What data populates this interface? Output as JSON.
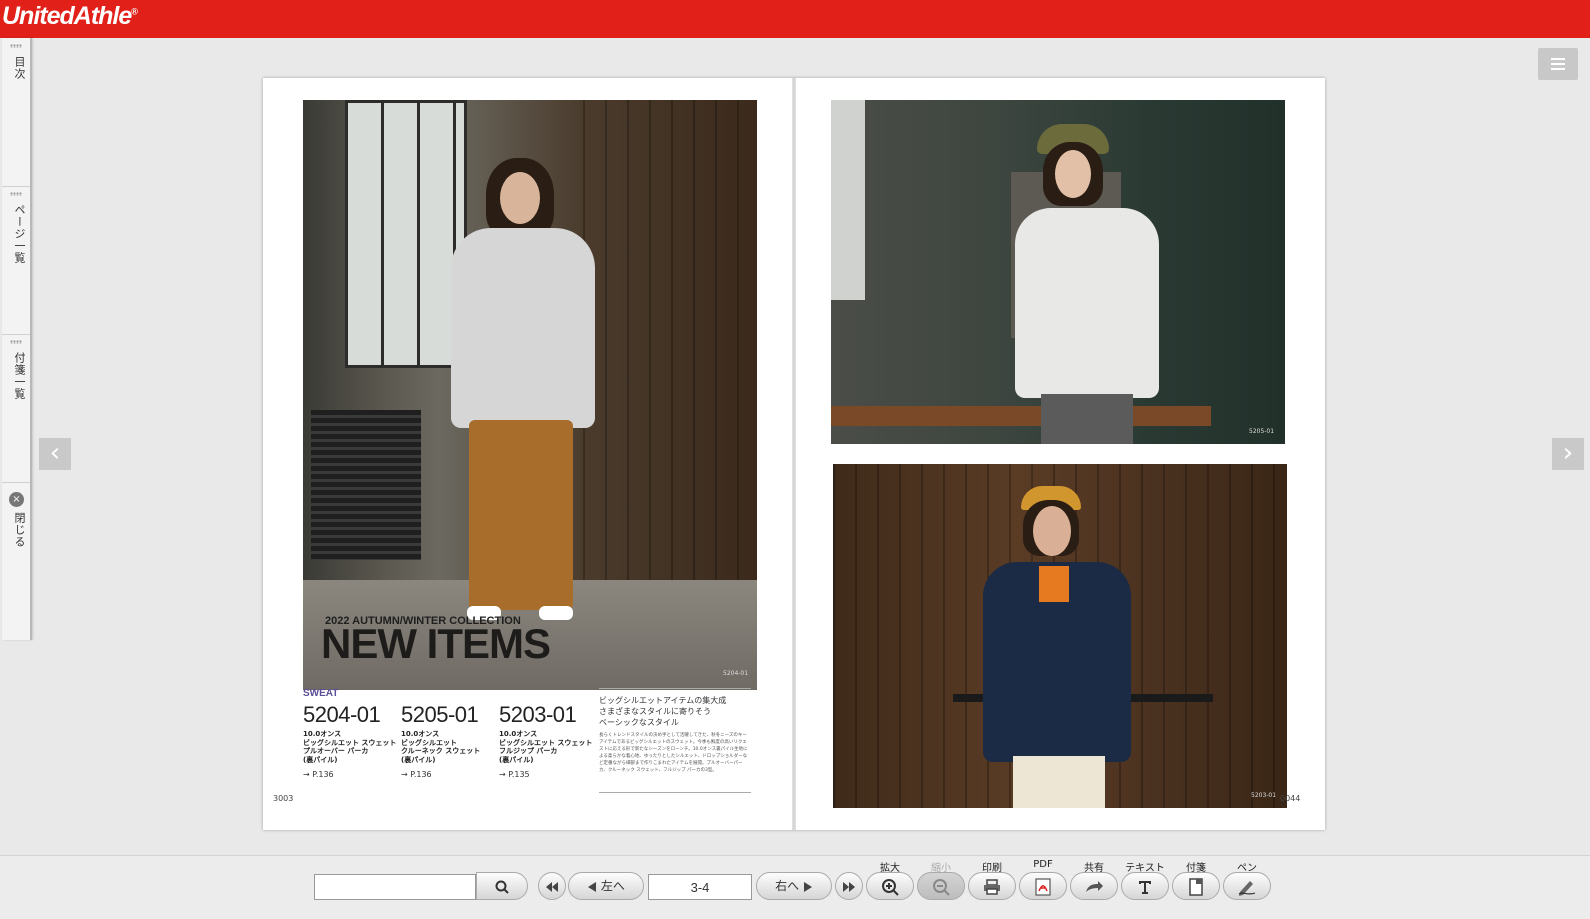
{
  "header": {
    "logo": "UnitedAthle",
    "logo_mark": "®"
  },
  "side_panel": {
    "tabs": [
      {
        "label": "目次"
      },
      {
        "label": "ページ一覧"
      },
      {
        "label": "付箋一覧"
      },
      {
        "label": "閉じる"
      }
    ]
  },
  "navigation": {
    "prev_icon": "chevron-left-icon",
    "next_icon": "chevron-right-icon",
    "menu_icon": "hamburger-icon"
  },
  "left_page": {
    "photo_subtitle": "2022 AUTUMN/WINTER COLLECTION",
    "photo_title": "NEW ITEMS",
    "photo_code": "5204-01",
    "category": "SWEAT",
    "products": [
      {
        "number": "5204-01",
        "line1": "10.0オンス",
        "line2": "ビッグシルエット スウェット",
        "line3": "プルオーバー パーカ",
        "line4": "(裏パイル)",
        "ref": "→ P.136"
      },
      {
        "number": "5205-01",
        "line1": "10.0オンス",
        "line2": "ビッグシルエット",
        "line3": "クルーネック スウェット",
        "line4": "(裏パイル)",
        "ref": "→ P.136"
      },
      {
        "number": "5203-01",
        "line1": "10.0オンス",
        "line2": "ビッグシルエット スウェット",
        "line3": "フルジップ パーカ",
        "line4": "(裏パイル)",
        "ref": "→ P.135"
      }
    ],
    "lead_line1": "ビッグシルエットアイテムの集大成",
    "lead_line2": "さまざまなスタイルに寄りそう",
    "lead_line3": "ベーシックなスタイル",
    "body_text": "長らくトレンドスタイルの決め手として活躍してきた、秋冬ニーズのキーアイテムであるビッグシルエットのスウェット。今季も鮮度の高いリクエストに応える形で新たなシーズンをローンチ。10.0オンス裏パイル生地による柔らかな着心地、ゆったりとしたシルエット、ドロップショルダーなど定番ながら細部まで作りこまれたアイテムを展開。プルオーバーパーカ、クルーネック スウェット、フルジップ パーカの3型。",
    "page_number": "3003"
  },
  "right_page": {
    "top_photo_code": "5205-01",
    "bottom_photo_code": "5203-01",
    "page_number": "0044"
  },
  "toolbar": {
    "search_placeholder": "",
    "search_icon": "search-icon",
    "first_icon": "rewind-icon",
    "left_label": "左へ",
    "page_value": "3-4",
    "right_label": "右へ",
    "last_icon": "fast-forward-icon",
    "tools": [
      {
        "label": "拡大",
        "icon": "zoom-in-icon"
      },
      {
        "label": "縮小",
        "icon": "zoom-out-icon"
      },
      {
        "label": "印刷",
        "icon": "printer-icon"
      },
      {
        "label": "PDF",
        "icon": "pdf-icon"
      },
      {
        "label": "共有",
        "icon": "share-icon"
      },
      {
        "label": "テキスト",
        "icon": "text-icon"
      },
      {
        "label": "付箋",
        "icon": "sticky-note-icon"
      },
      {
        "label": "ペン",
        "icon": "pen-icon"
      }
    ]
  },
  "colors": {
    "brand": "#e02019",
    "category": "#5b4f96",
    "background": "#e9e9e9"
  }
}
